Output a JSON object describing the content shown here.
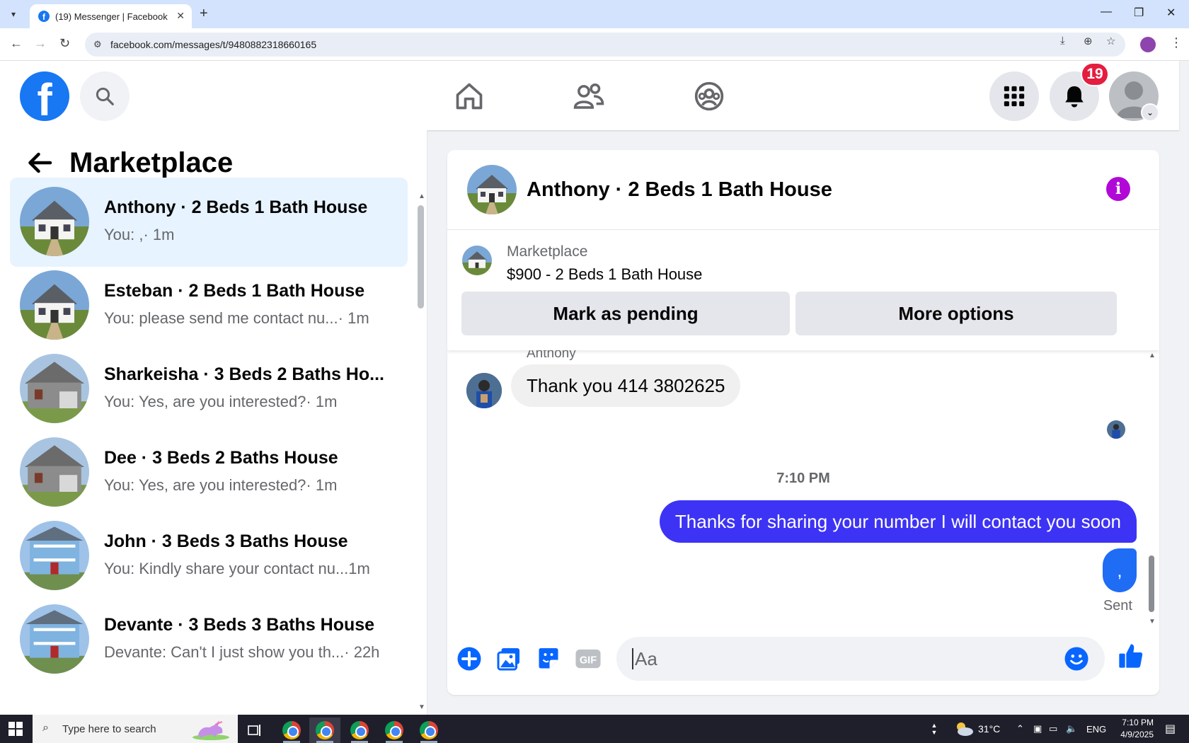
{
  "browser": {
    "tab_title": "(19) Messenger | Facebook",
    "url": "facebook.com/messages/t/9480882318660165"
  },
  "header": {
    "notification_count": "19"
  },
  "left_panel": {
    "title": "Marketplace",
    "conversations": [
      {
        "title": "Anthony · 2 Beds 1 Bath House",
        "snippet": "You: , ",
        "time": "· 1m",
        "active": true
      },
      {
        "title": "Esteban · 2 Beds 1 Bath House",
        "snippet": "You: please send me contact nu...",
        "time": " · 1m",
        "active": false
      },
      {
        "title": "Sharkeisha · 3 Beds 2 Baths Ho...",
        "snippet": "You: Yes, are you interested?",
        "time": " · 1m",
        "active": false
      },
      {
        "title": "Dee · 3 Beds 2 Baths House",
        "snippet": "You: Yes, are you interested?",
        "time": " · 1m",
        "active": false
      },
      {
        "title": "John · 3 Beds 3 Baths House",
        "snippet": "You: Kindly share your contact nu...",
        "time": " 1m",
        "active": false
      },
      {
        "title": "Devante · 3 Beds 3 Baths House",
        "snippet": "Devante: Can't I just show you th...",
        "time": " · 22h",
        "active": false
      }
    ]
  },
  "chat": {
    "title": "Anthony · 2 Beds 1 Bath House",
    "listing_source": "Marketplace",
    "listing_price": "$900 - 2 Beds 1 Bath House",
    "mark_pending_label": "Mark as pending",
    "more_options_label": "More options",
    "sender_name": "Anthony",
    "incoming_message": "Thank you 414 3802625",
    "timestamp": "7:10 PM",
    "outgoing_message": "Thanks for sharing your number I will contact you soon",
    "outgoing_small": ",",
    "sent_label": "Sent",
    "composer_placeholder": "Aa",
    "gif_label": "GIF"
  },
  "taskbar": {
    "search_placeholder": "Type here to search",
    "temperature": "31°C",
    "language": "ENG",
    "time": "7:10 PM",
    "date": "4/9/2025"
  },
  "colors": {
    "fb_blue": "#1877f2",
    "outgoing_bubble": "#3d33f5",
    "info_purple": "#b108d8",
    "badge_red": "#e41e3f"
  }
}
